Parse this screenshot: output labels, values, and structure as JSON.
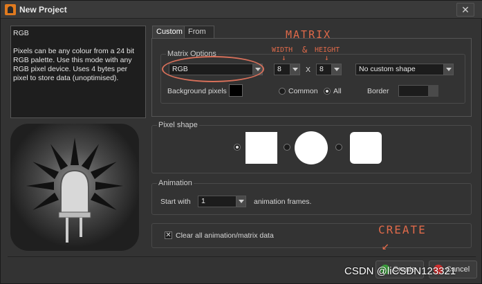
{
  "window": {
    "title": "New Project",
    "close_label": "✕"
  },
  "description": {
    "mode": "RGB",
    "text": "Pixels can be any colour from a 24 bit RGB palette. Use this mode with any RGB pixel device. Uses 4 bytes per pixel to store data (unoptimised)."
  },
  "tabs": [
    {
      "label": "Custom"
    },
    {
      "label": "From Preset"
    }
  ],
  "matrix_options": {
    "group_label": "Matrix Options",
    "mode_value": "RGB",
    "width_value": "8",
    "x_label": "X",
    "height_value": "8",
    "custom_shape_value": "No custom shape",
    "background_label": "Background pixels",
    "background_color": "#000000",
    "common_label": "Common",
    "all_label": "All",
    "border_label": "Border"
  },
  "pixel_shape": {
    "group_label": "Pixel shape"
  },
  "animation": {
    "group_label": "Animation",
    "start_with_label": "Start with",
    "frames_value": "1",
    "frames_suffix": "animation frames."
  },
  "clear_data": {
    "checked": true,
    "label": "Clear all animation/matrix data"
  },
  "buttons": {
    "create": "Create",
    "cancel": "Cancel"
  },
  "annotations": {
    "matrix": "MATRIX",
    "width": "WIDTH",
    "ampersand": "&",
    "height": "HEIGHT",
    "create": "CREATE"
  },
  "watermark": "CSDN @liCSDN123321",
  "colors": {
    "accent_annotation": "#e06a4a",
    "create_icon": "#3aa03a",
    "cancel_icon": "#d63030"
  }
}
